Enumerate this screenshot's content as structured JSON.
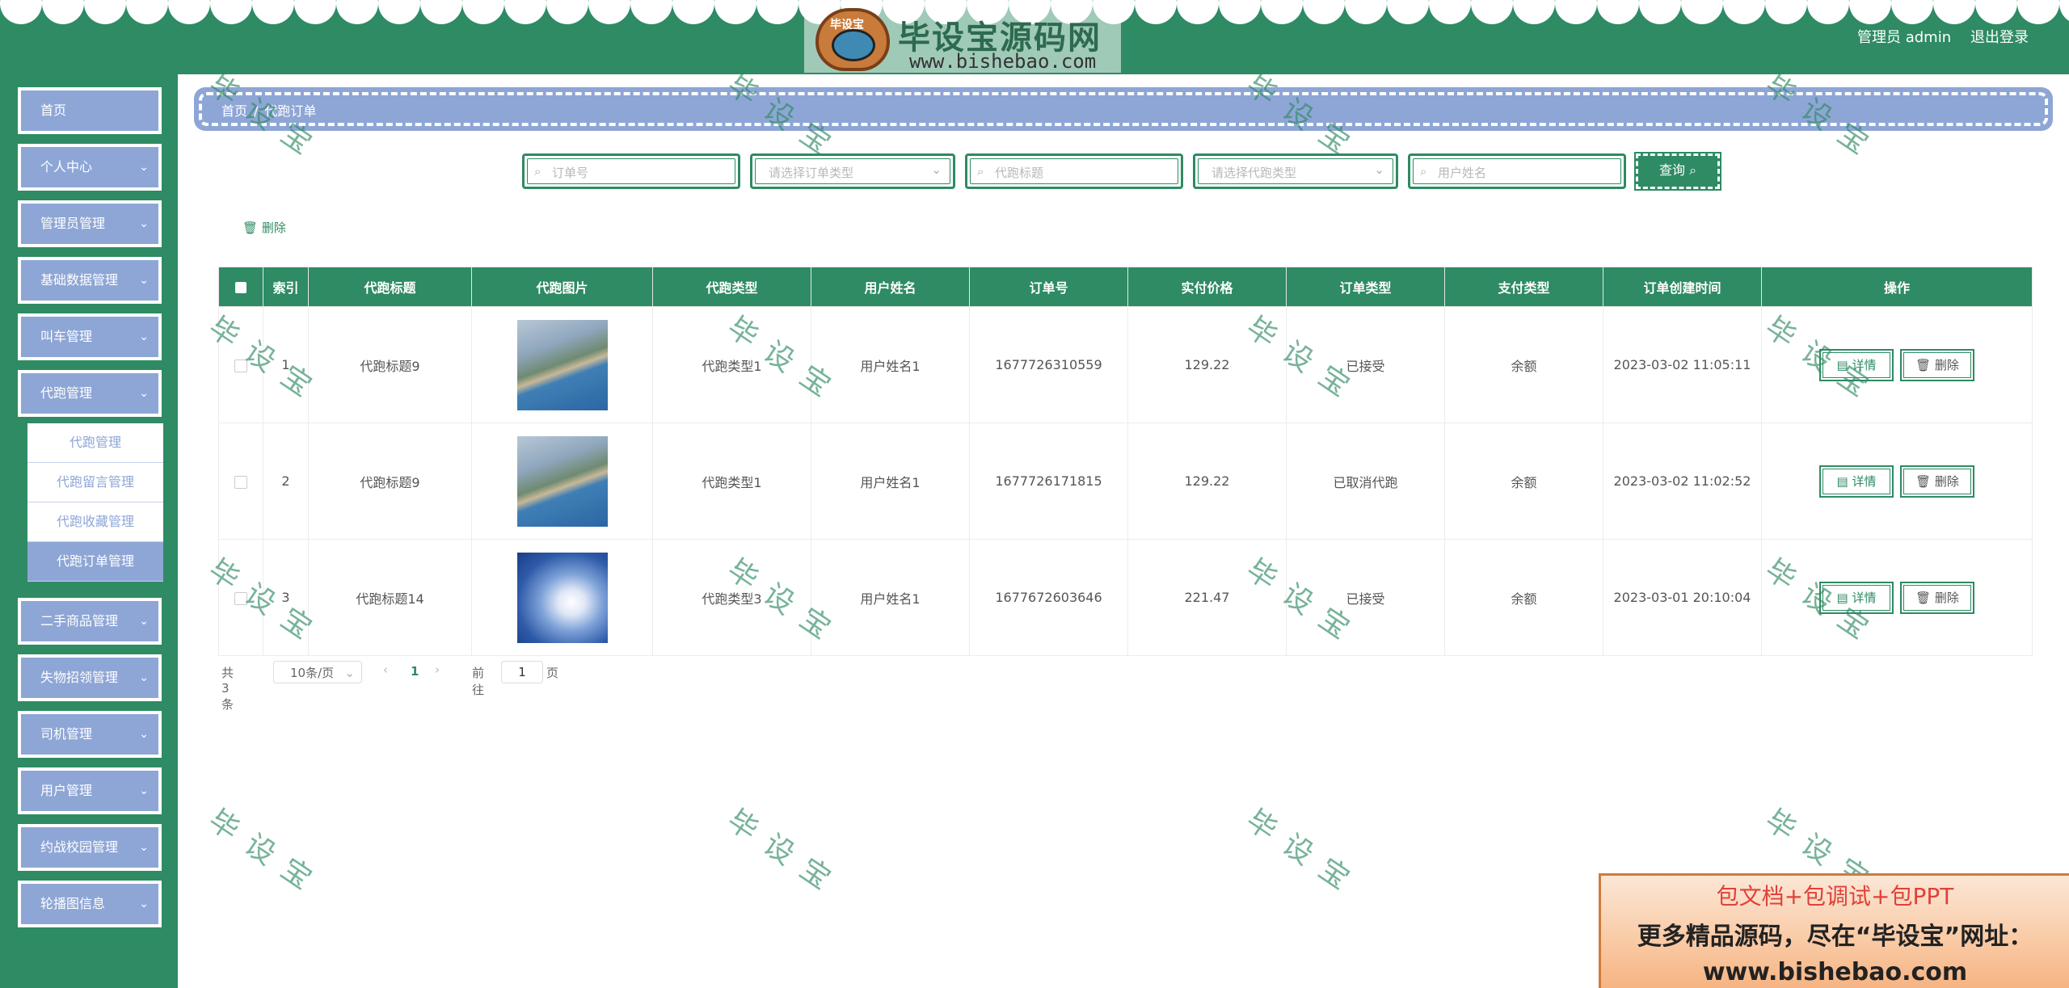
{
  "header": {
    "logo_name": "毕设宝源码网",
    "logo_tag": "毕设宝",
    "logo_url": "www.bishebao.com",
    "admin_label": "管理员 admin",
    "logout_label": "退出登录"
  },
  "sidebar": {
    "items": [
      {
        "label": "首页"
      },
      {
        "label": "个人中心"
      },
      {
        "label": "管理员管理"
      },
      {
        "label": "基础数据管理"
      },
      {
        "label": "叫车管理"
      },
      {
        "label": "代跑管理"
      },
      {
        "label": "二手商品管理"
      },
      {
        "label": "失物招领管理"
      },
      {
        "label": "司机管理"
      },
      {
        "label": "用户管理"
      },
      {
        "label": "约战校园管理"
      },
      {
        "label": "轮播图信息"
      }
    ],
    "sub_items": [
      {
        "label": "代跑管理"
      },
      {
        "label": "代跑留言管理"
      },
      {
        "label": "代跑收藏管理"
      },
      {
        "label": "代跑订单管理"
      }
    ]
  },
  "breadcrumb": {
    "home": "首页",
    "separator": "/",
    "current": "代跑订单"
  },
  "search": {
    "order_no_placeholder": "订单号",
    "order_type_placeholder": "请选择订单类型",
    "title_placeholder": "代跑标题",
    "run_type_placeholder": "请选择代跑类型",
    "username_placeholder": "用户姓名",
    "query_label": "查询"
  },
  "toolbar": {
    "delete_label": "删除"
  },
  "table": {
    "headers": [
      "索引",
      "代跑标题",
      "代跑图片",
      "代跑类型",
      "用户姓名",
      "订单号",
      "实付价格",
      "订单类型",
      "支付类型",
      "订单创建时间",
      "操作"
    ],
    "rows": [
      {
        "index": "1",
        "title": "代跑标题9",
        "image": "coast",
        "type": "代跑类型1",
        "username": "用户姓名1",
        "order_no": "1677726310559",
        "price": "129.22",
        "order_type": "已接受",
        "pay_type": "余额",
        "created": "2023-03-02 11:05:11"
      },
      {
        "index": "2",
        "title": "代跑标题9",
        "image": "coast",
        "type": "代跑类型1",
        "username": "用户姓名1",
        "order_no": "1677726171815",
        "price": "129.22",
        "order_type": "已取消代跑",
        "pay_type": "余额",
        "created": "2023-03-02 11:02:52"
      },
      {
        "index": "3",
        "title": "代跑标题14",
        "image": "sky",
        "type": "代跑类型3",
        "username": "用户姓名1",
        "order_no": "1677672603646",
        "price": "221.47",
        "order_type": "已接受",
        "pay_type": "余额",
        "created": "2023-03-01 20:10:04"
      }
    ],
    "detail_label": "详情",
    "delete_label": "删除"
  },
  "pagination": {
    "total": "共 3 条",
    "page_size": "10条/页",
    "current_page": "1",
    "goto_label": "前往",
    "goto_value": "1",
    "page_unit": "页"
  },
  "watermark": "毕设宝",
  "ad": {
    "line1": "包文档+包调试+包PPT",
    "line2": "更多精品源码，尽在“毕设宝”网址：",
    "line3": "www.bishebao.com"
  },
  "colors": {
    "primary": "#2e8b63",
    "menu": "#8ea6d6"
  }
}
